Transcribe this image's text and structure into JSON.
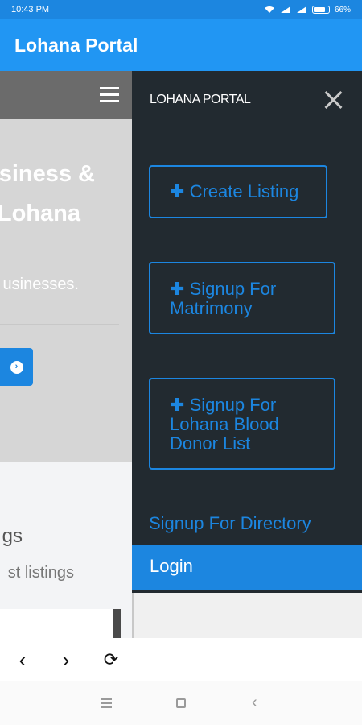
{
  "status_bar": {
    "time": "10:43 PM",
    "battery": "66%"
  },
  "app_bar": {
    "title": "Lohana Portal"
  },
  "web_page": {
    "hero_line1": "siness &",
    "hero_line2": "Lohana",
    "hero_sub": "usinesses.",
    "listings_title": "gs",
    "listings_sub": "st listings"
  },
  "drawer": {
    "title": "LOHANA PORTAL",
    "buttons": [
      {
        "label": "Create Listing"
      },
      {
        "label": "Signup For Matrimony"
      },
      {
        "label": "Signup For Lohana Blood Donor List"
      }
    ],
    "directory_link": "Signup For Directory",
    "login": "Login"
  },
  "colors": {
    "accent": "#1c86e0",
    "app_bar": "#2196f3",
    "drawer_bg": "#222a30"
  },
  "icons": [
    "wifi-icon",
    "signal-icon",
    "battery-icon",
    "hamburger-menu-icon",
    "close-icon",
    "plus-icon",
    "chevron-right-circle-icon",
    "back-arrow-icon",
    "forward-arrow-icon",
    "refresh-icon",
    "recents-icon",
    "home-icon",
    "nav-back-icon"
  ]
}
